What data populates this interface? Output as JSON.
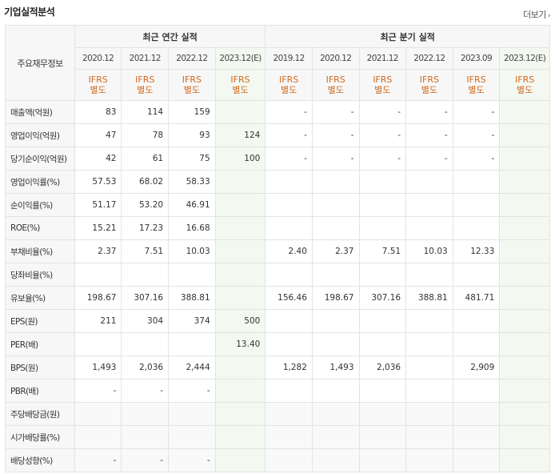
{
  "header": {
    "title": "기업실적분석",
    "more_label": "더보기"
  },
  "table": {
    "label_header": "주요재무정보",
    "group_annual": "최근 연간 실적",
    "group_quarter": "최근 분기 실적",
    "annual_years": [
      "2020.12",
      "2021.12",
      "2022.12",
      "2023.12(E)"
    ],
    "quarter_years": [
      "2019.12",
      "2020.12",
      "2021.12",
      "2022.12",
      "2023.09",
      "2023.12(E)"
    ],
    "ifrs_line1": "IFRS",
    "ifrs_line2": "별도",
    "rows": [
      {
        "label": "매출액(억원)",
        "annual": [
          "83",
          "114",
          "159",
          ""
        ],
        "quarter": [
          "-",
          "-",
          "-",
          "-",
          "-",
          ""
        ]
      },
      {
        "label": "영업이익(억원)",
        "annual": [
          "47",
          "78",
          "93",
          "124"
        ],
        "quarter": [
          "-",
          "-",
          "-",
          "-",
          "-",
          ""
        ]
      },
      {
        "label": "당기순이익(억원)",
        "annual": [
          "42",
          "61",
          "75",
          "100"
        ],
        "quarter": [
          "-",
          "-",
          "-",
          "-",
          "-",
          ""
        ]
      },
      {
        "label": "영업이익률(%)",
        "annual": [
          "57.53",
          "68.02",
          "58.33",
          ""
        ],
        "quarter": [
          "",
          "",
          "",
          "",
          "",
          ""
        ]
      },
      {
        "label": "순이익률(%)",
        "annual": [
          "51.17",
          "53.20",
          "46.91",
          ""
        ],
        "quarter": [
          "",
          "",
          "",
          "",
          "",
          ""
        ]
      },
      {
        "label": "ROE(%)",
        "annual": [
          "15.21",
          "17.23",
          "16.68",
          ""
        ],
        "quarter": [
          "",
          "",
          "",
          "",
          "",
          ""
        ]
      },
      {
        "label": "부채비율(%)",
        "annual": [
          "2.37",
          "7.51",
          "10.03",
          ""
        ],
        "quarter": [
          "2.40",
          "2.37",
          "7.51",
          "10.03",
          "12.33",
          ""
        ]
      },
      {
        "label": "당좌비율(%)",
        "annual": [
          "",
          "",
          "",
          ""
        ],
        "quarter": [
          "",
          "",
          "",
          "",
          "",
          ""
        ]
      },
      {
        "label": "유보율(%)",
        "annual": [
          "198.67",
          "307.16",
          "388.81",
          ""
        ],
        "quarter": [
          "156.46",
          "198.67",
          "307.16",
          "388.81",
          "481.71",
          ""
        ]
      },
      {
        "label": "EPS(원)",
        "annual": [
          "211",
          "304",
          "374",
          "500"
        ],
        "quarter": [
          "",
          "",
          "",
          "",
          "",
          ""
        ]
      },
      {
        "label": "PER(배)",
        "annual": [
          "",
          "",
          "",
          "13.40"
        ],
        "quarter": [
          "",
          "",
          "",
          "",
          "",
          ""
        ]
      },
      {
        "label": "BPS(원)",
        "annual": [
          "1,493",
          "2,036",
          "2,444",
          ""
        ],
        "quarter": [
          "1,282",
          "1,493",
          "2,036",
          "",
          "2,909",
          ""
        ]
      },
      {
        "label": "PBR(배)",
        "annual": [
          "-",
          "-",
          "-",
          ""
        ],
        "quarter": [
          "",
          "",
          "",
          "",
          "",
          ""
        ]
      },
      {
        "label": "주당배당금(원)",
        "annual": [
          "",
          "",
          "",
          ""
        ],
        "quarter": [
          "",
          "",
          "",
          "",
          "",
          ""
        ]
      },
      {
        "label": "시가배당률(%)",
        "annual": [
          "",
          "",
          "",
          ""
        ],
        "quarter": [
          "",
          "",
          "",
          "",
          "",
          ""
        ]
      },
      {
        "label": "배당성향(%)",
        "annual": [
          "-",
          "-",
          "-",
          ""
        ],
        "quarter": [
          "",
          "",
          "",
          "",
          "",
          ""
        ]
      }
    ]
  }
}
